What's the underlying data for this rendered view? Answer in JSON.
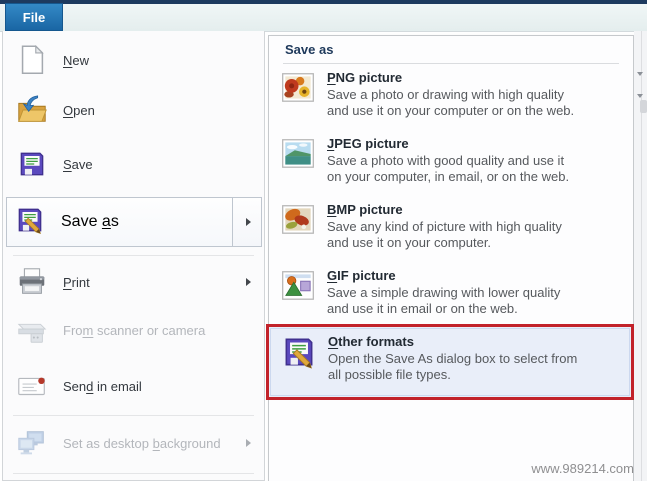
{
  "window": {
    "file_tab_label": "File",
    "watermark": "www.989214.com"
  },
  "file_menu": {
    "items": [
      {
        "pre": "",
        "accel": "N",
        "post": "ew",
        "icon": "new-document-icon",
        "disabled": false,
        "has_submenu_arrow": false,
        "selected": false
      },
      {
        "pre": "",
        "accel": "O",
        "post": "pen",
        "icon": "open-folder-icon",
        "disabled": false,
        "has_submenu_arrow": false,
        "selected": false
      },
      {
        "pre": "",
        "accel": "S",
        "post": "ave",
        "icon": "save-floppy-icon",
        "disabled": false,
        "has_submenu_arrow": false,
        "selected": false
      },
      {
        "pre": "Save ",
        "accel": "a",
        "post": "s",
        "icon": "save-as-floppy-pencil-icon",
        "disabled": false,
        "has_submenu_arrow": true,
        "selected": true
      },
      {
        "pre": "",
        "accel": "P",
        "post": "rint",
        "icon": "printer-icon",
        "disabled": false,
        "has_submenu_arrow": true,
        "selected": false
      },
      {
        "pre": "Fro",
        "accel": "m",
        "post": " scanner or camera",
        "icon": "scanner-icon",
        "disabled": true,
        "has_submenu_arrow": false,
        "selected": false
      },
      {
        "pre": "Sen",
        "accel": "d",
        "post": " in email",
        "icon": "email-envelope-icon",
        "disabled": false,
        "has_submenu_arrow": false,
        "selected": false
      },
      {
        "pre": "Set as desktop ",
        "accel": "b",
        "post": "ackground",
        "icon": "desktop-monitors-icon",
        "disabled": true,
        "has_submenu_arrow": true,
        "selected": false
      }
    ]
  },
  "submenu": {
    "header": "Save as",
    "items": [
      {
        "pre": "",
        "accel": "P",
        "post": "NG picture",
        "desc_line1": "Save a photo or drawing with high quality",
        "desc_line2": "and use it on your computer or on the web.",
        "icon": "png-picture-icon",
        "highlighted": false
      },
      {
        "pre": "",
        "accel": "J",
        "post": "PEG picture",
        "desc_line1": "Save a photo with good quality and use it",
        "desc_line2": "on your computer, in email, or on the web.",
        "icon": "jpeg-picture-icon",
        "highlighted": false
      },
      {
        "pre": "",
        "accel": "B",
        "post": "MP picture",
        "desc_line1": "Save any kind of picture with high quality",
        "desc_line2": "and use it on your computer.",
        "icon": "bmp-picture-icon",
        "highlighted": false
      },
      {
        "pre": "",
        "accel": "G",
        "post": "IF picture",
        "desc_line1": "Save a simple drawing with lower quality",
        "desc_line2": "and use it in email or on the web.",
        "icon": "gif-picture-icon",
        "highlighted": false
      },
      {
        "pre": "",
        "accel": "O",
        "post": "ther formats",
        "desc_line1": "Open the Save As dialog box to select from",
        "desc_line2": "all possible file types.",
        "icon": "other-formats-floppy-icon",
        "highlighted": true
      }
    ]
  },
  "colors": {
    "file_tab_blue": "#1a66a4",
    "title_bar_navy": "#1d3a5f",
    "highlight_red": "#c2222a",
    "selection_border": "#bfc6cf",
    "highlight_row_bg": "#e9eef9",
    "menu_text": "#33383e",
    "disabled_text": "#b3b6bb",
    "description_text": "#56595d"
  }
}
